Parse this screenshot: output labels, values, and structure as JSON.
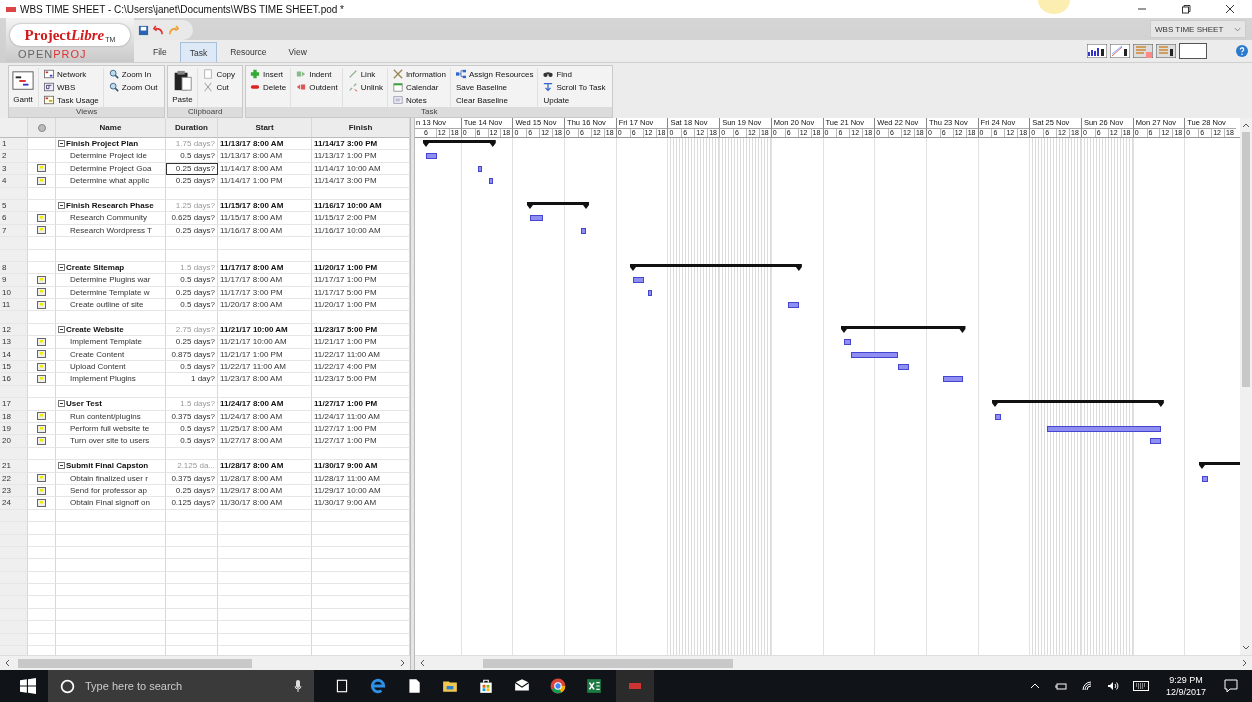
{
  "window": {
    "title": "WBS TIME SHEET - C:\\Users\\janet\\Documents\\WBS TIME SHEET.pod *"
  },
  "logo": {
    "name": "Project",
    "name_italic": "Libre",
    "trademark": "TM",
    "sub_left": "OPEN",
    "sub_right": "PROJ"
  },
  "tabs": [
    {
      "label": "File",
      "selected": false
    },
    {
      "label": "Task",
      "selected": true
    },
    {
      "label": "Resource",
      "selected": false
    },
    {
      "label": "View",
      "selected": false
    }
  ],
  "document_selector": {
    "value": "WBS TIME SHEET"
  },
  "ribbon_groups": [
    {
      "title": "Views",
      "columns": [
        [
          {
            "label": "Gantt",
            "kind": "large"
          }
        ],
        [
          {
            "label": "Network",
            "kind": "small"
          },
          {
            "label": "WBS",
            "kind": "small"
          },
          {
            "label": "Task Usage",
            "kind": "small"
          }
        ],
        [
          {
            "label": "Zoom In",
            "kind": "small"
          },
          {
            "label": "Zoom Out",
            "kind": "small"
          }
        ]
      ]
    },
    {
      "title": "Clipboard",
      "columns": [
        [
          {
            "label": "Paste",
            "kind": "large"
          }
        ],
        [
          {
            "label": "Copy",
            "kind": "small"
          },
          {
            "label": "Cut",
            "kind": "small"
          }
        ]
      ]
    },
    {
      "title": "Task",
      "columns": [
        [
          {
            "label": "Insert",
            "kind": "small"
          },
          {
            "label": "Delete",
            "kind": "small"
          }
        ],
        [
          {
            "label": "Indent",
            "kind": "small"
          },
          {
            "label": "Outdent",
            "kind": "small"
          }
        ],
        [
          {
            "label": "Link",
            "kind": "small"
          },
          {
            "label": "Unlink",
            "kind": "small"
          }
        ],
        [
          {
            "label": "Information",
            "kind": "small"
          },
          {
            "label": "Calendar",
            "kind": "small"
          },
          {
            "label": "Notes",
            "kind": "small"
          }
        ],
        [
          {
            "label": "Assign Resources",
            "kind": "small"
          },
          {
            "label": "Save Baseline",
            "kind": "small"
          },
          {
            "label": "Clear Baseline",
            "kind": "small"
          }
        ],
        [
          {
            "label": "Find",
            "kind": "small"
          },
          {
            "label": "Scroll To Task",
            "kind": "small"
          },
          {
            "label": "Update",
            "kind": "small"
          }
        ]
      ]
    }
  ],
  "table": {
    "columns": [
      "Name",
      "Duration",
      "Start",
      "Finish"
    ],
    "rows": [
      {
        "kind": "summary",
        "id": "1",
        "name": "Finish Project Plan",
        "duration": "1.75 days?",
        "start": "11/13/17 8:00 AM",
        "finish": "11/14/17 3:00 PM",
        "duration_selected": false
      },
      {
        "kind": "task",
        "id": "2",
        "name": "Determine Project ide",
        "note": false,
        "duration": "0.5 days?",
        "start": "11/13/17 8:00 AM",
        "finish": "11/13/17 1:00 PM",
        "duration_selected": false
      },
      {
        "kind": "task",
        "id": "3",
        "name": "Determine Project Goa",
        "note": true,
        "duration": "0.25 days?",
        "start": "11/14/17 8:00 AM",
        "finish": "11/14/17 10:00 AM",
        "duration_selected": true
      },
      {
        "kind": "task",
        "id": "4",
        "name": "Determine what applic",
        "note": true,
        "duration": "0.25 days?",
        "start": "11/14/17 1:00 PM",
        "finish": "11/14/17 3:00 PM",
        "duration_selected": false
      },
      {
        "kind": "blank"
      },
      {
        "kind": "summary",
        "id": "5",
        "name": "Finish Research Phase",
        "duration": "1.25 days?",
        "start": "11/15/17 8:00 AM",
        "finish": "11/16/17 10:00 AM",
        "duration_selected": false
      },
      {
        "kind": "task",
        "id": "6",
        "name": "Research Community",
        "note": true,
        "duration": "0.625 days?",
        "start": "11/15/17 8:00 AM",
        "finish": "11/15/17 2:00 PM",
        "duration_selected": false
      },
      {
        "kind": "task",
        "id": "7",
        "name": "Research Wordpress T",
        "note": true,
        "duration": "0.25 days?",
        "start": "11/16/17 8:00 AM",
        "finish": "11/16/17 10:00 AM",
        "duration_selected": false
      },
      {
        "kind": "blank"
      },
      {
        "kind": "blank"
      },
      {
        "kind": "summary",
        "id": "8",
        "name": "Create Sitemap",
        "duration": "1.5 days?",
        "start": "11/17/17 8:00 AM",
        "finish": "11/20/17 1:00 PM",
        "duration_selected": false
      },
      {
        "kind": "task",
        "id": "9",
        "name": "Determine Plugins war",
        "note": true,
        "duration": "0.5 days?",
        "start": "11/17/17 8:00 AM",
        "finish": "11/17/17 1:00 PM",
        "duration_selected": false
      },
      {
        "kind": "task",
        "id": "10",
        "name": "Determine Template w",
        "note": true,
        "duration": "0.25 days?",
        "start": "11/17/17 3:00 PM",
        "finish": "11/17/17 5:00 PM",
        "duration_selected": false
      },
      {
        "kind": "task",
        "id": "11",
        "name": "Create outline of site",
        "note": true,
        "duration": "0.5 days?",
        "start": "11/20/17 8:00 AM",
        "finish": "11/20/17 1:00 PM",
        "duration_selected": false
      },
      {
        "kind": "blank"
      },
      {
        "kind": "summary",
        "id": "12",
        "name": "Create Website",
        "duration": "2.75 days?",
        "start": "11/21/17 10:00 AM",
        "finish": "11/23/17 5:00 PM",
        "duration_selected": false
      },
      {
        "kind": "task",
        "id": "13",
        "name": "Implement Template",
        "note": true,
        "duration": "0.25 days?",
        "start": "11/21/17 10:00 AM",
        "finish": "11/21/17 1:00 PM",
        "duration_selected": false
      },
      {
        "kind": "task",
        "id": "14",
        "name": "Create Content",
        "note": true,
        "duration": "0.875 days?",
        "start": "11/21/17 1:00 PM",
        "finish": "11/22/17 11:00 AM",
        "duration_selected": false
      },
      {
        "kind": "task",
        "id": "15",
        "name": "Upload Content",
        "note": true,
        "duration": "0.5 days?",
        "start": "11/22/17 11:00 AM",
        "finish": "11/22/17 4:00 PM",
        "duration_selected": false
      },
      {
        "kind": "task",
        "id": "16",
        "name": "Implement Plugins",
        "note": true,
        "duration": "1 day?",
        "start": "11/23/17 8:00 AM",
        "finish": "11/23/17 5:00 PM",
        "duration_selected": false
      },
      {
        "kind": "blank"
      },
      {
        "kind": "summary",
        "id": "17",
        "name": "User Test",
        "duration": "1.5 days?",
        "start": "11/24/17 8:00 AM",
        "finish": "11/27/17 1:00 PM",
        "duration_selected": false
      },
      {
        "kind": "task",
        "id": "18",
        "name": "Run content/plugins",
        "note": true,
        "duration": "0.375 days?",
        "start": "11/24/17 8:00 AM",
        "finish": "11/24/17 11:00 AM",
        "duration_selected": false
      },
      {
        "kind": "task",
        "id": "19",
        "name": "Perform full website te",
        "note": true,
        "duration": "0.5 days?",
        "start": "11/25/17 8:00 AM",
        "finish": "11/27/17 1:00 PM",
        "duration_selected": false
      },
      {
        "kind": "task",
        "id": "20",
        "name": "Turn over site to users",
        "note": true,
        "duration": "0.5 days?",
        "start": "11/27/17 8:00 AM",
        "finish": "11/27/17 1:00 PM",
        "duration_selected": false
      },
      {
        "kind": "blank"
      },
      {
        "kind": "summary",
        "id": "21",
        "name": "Submit Final Capston",
        "duration": "2.125 da...",
        "start": "11/28/17 8:00 AM",
        "finish": "11/30/17 9:00 AM",
        "duration_selected": false
      },
      {
        "kind": "task",
        "id": "22",
        "name": "Obtain finalized user r",
        "note": true,
        "duration": "0.375 days?",
        "start": "11/28/17 8:00 AM",
        "finish": "11/28/17 11:00 AM",
        "duration_selected": false
      },
      {
        "kind": "task",
        "id": "23",
        "name": "Send for professor ap",
        "note": true,
        "duration": "0.25 days?",
        "start": "11/29/17 8:00 AM",
        "finish": "11/29/17 10:00 AM",
        "duration_selected": false
      },
      {
        "kind": "task",
        "id": "24",
        "name": "Obtain Final signoff on",
        "note": true,
        "duration": "0.125 days?",
        "start": "11/30/17 8:00 AM",
        "finish": "11/30/17 9:00 AM",
        "duration_selected": false
      }
    ]
  },
  "gantt": {
    "days": [
      {
        "label": "n 13 Nov",
        "hours": [
          "6",
          "12",
          "18"
        ],
        "weekend": false
      },
      {
        "label": "Tue 14 Nov",
        "hours": [
          "0",
          "6",
          "12",
          "18"
        ],
        "weekend": false
      },
      {
        "label": "Wed 15 Nov",
        "hours": [
          "0",
          "6",
          "12",
          "18"
        ],
        "weekend": false
      },
      {
        "label": "Thu 16 Nov",
        "hours": [
          "0",
          "6",
          "12",
          "18"
        ],
        "weekend": false
      },
      {
        "label": "Fri 17 Nov",
        "hours": [
          "0",
          "6",
          "12",
          "18"
        ],
        "weekend": false
      },
      {
        "label": "Sat 18 Nov",
        "hours": [
          "0",
          "6",
          "12",
          "18"
        ],
        "weekend": true
      },
      {
        "label": "Sun 19 Nov",
        "hours": [
          "0",
          "6",
          "12",
          "18"
        ],
        "weekend": true
      },
      {
        "label": "Mon 20 Nov",
        "hours": [
          "0",
          "6",
          "12",
          "18"
        ],
        "weekend": false
      },
      {
        "label": "Tue 21 Nov",
        "hours": [
          "0",
          "6",
          "12",
          "18"
        ],
        "weekend": false
      },
      {
        "label": "Wed 22 Nov",
        "hours": [
          "0",
          "6",
          "12",
          "18"
        ],
        "weekend": false
      },
      {
        "label": "Thu 23 Nov",
        "hours": [
          "0",
          "6",
          "12",
          "18"
        ],
        "weekend": false
      },
      {
        "label": "Fri 24 Nov",
        "hours": [
          "0",
          "6",
          "12",
          "18"
        ],
        "weekend": false
      },
      {
        "label": "Sat 25 Nov",
        "hours": [
          "0",
          "6",
          "12",
          "18"
        ],
        "weekend": true
      },
      {
        "label": "Sun 26 Nov",
        "hours": [
          "0",
          "6",
          "12",
          "18"
        ],
        "weekend": true
      },
      {
        "label": "Mon 27 Nov",
        "hours": [
          "0",
          "6",
          "12",
          "18"
        ],
        "weekend": false
      },
      {
        "label": "Tue 28 Nov",
        "hours": [
          "0",
          "6",
          "12",
          "18"
        ],
        "weekend": false
      }
    ]
  },
  "taskbar": {
    "search_placeholder": "Type here to search",
    "time": "9:29 PM",
    "date": "12/9/2017"
  }
}
